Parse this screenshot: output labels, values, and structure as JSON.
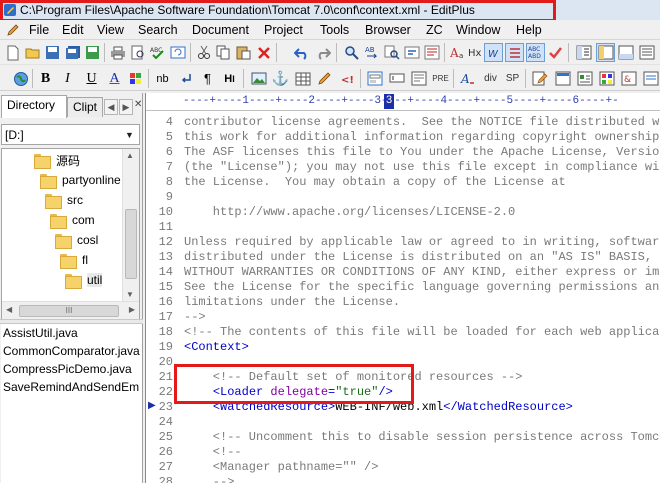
{
  "window": {
    "title": "C:\\Program Files\\Apache Software Foundation\\Tomcat 7.0\\conf\\context.xml - EditPlus",
    "app_icon": "editplus-icon"
  },
  "menu": [
    "File",
    "Edit",
    "View",
    "Search",
    "Document",
    "Project",
    "Tools",
    "Browser",
    "ZC",
    "Window",
    "Help"
  ],
  "toolbar2_labels": {
    "bold": "B",
    "italic": "I",
    "underline": "U",
    "fontcolor": "A",
    "nb": "nb",
    "pilcrow": "¶",
    "h": "H",
    "anchor": "⚓",
    "hx": "Hx",
    "pre": "PRE",
    "div": "div",
    "sp": "SP"
  },
  "sidebar": {
    "tabs": [
      "Directory",
      "Clipt"
    ],
    "drive": "[D:]",
    "tree": [
      {
        "label": "源码",
        "depth": 0
      },
      {
        "label": "partyonline",
        "depth": 1
      },
      {
        "label": "src",
        "depth": 2
      },
      {
        "label": "com",
        "depth": 3
      },
      {
        "label": "cosl",
        "depth": 4
      },
      {
        "label": "fl",
        "depth": 5
      },
      {
        "label": "util",
        "depth": 6,
        "selected": true
      }
    ],
    "hscroll_grip": "III",
    "files": [
      "AssistUtil.java",
      "CommonComparator.java",
      "CompressPicDemo.java",
      "SaveRemindAndSendEm"
    ]
  },
  "editor": {
    "ruler": "----+----1----+----2----+----3----+----4----+----5----+----6----+-",
    "cursor_column": "3",
    "current_line": "23",
    "lines": [
      {
        "n": "4",
        "segs": [
          [
            "c-comment",
            "contributor license agreements.  See the NOTICE file distributed w"
          ]
        ]
      },
      {
        "n": "5",
        "segs": [
          [
            "c-comment",
            "this work for additional information regarding copyright ownership"
          ]
        ]
      },
      {
        "n": "6",
        "segs": [
          [
            "c-comment",
            "The ASF licenses this file to You under the Apache License, Versio"
          ]
        ]
      },
      {
        "n": "7",
        "segs": [
          [
            "c-comment",
            "(the \"License\"); you may not use this file except in compliance wi"
          ]
        ]
      },
      {
        "n": "8",
        "segs": [
          [
            "c-comment",
            "the License.  You may obtain a copy of the License at"
          ]
        ]
      },
      {
        "n": "9",
        "segs": []
      },
      {
        "n": "10",
        "segs": [
          [
            "c-comment",
            "    http://www.apache.org/licenses/LICENSE-2.0"
          ]
        ]
      },
      {
        "n": "11",
        "segs": []
      },
      {
        "n": "12",
        "segs": [
          [
            "c-comment",
            "Unless required by applicable law or agreed to in writing, softwar"
          ]
        ]
      },
      {
        "n": "13",
        "segs": [
          [
            "c-comment",
            "distributed under the License is distributed on an \"AS IS\" BASIS,"
          ]
        ]
      },
      {
        "n": "14",
        "segs": [
          [
            "c-comment",
            "WITHOUT WARRANTIES OR CONDITIONS OF ANY KIND, either express or im"
          ]
        ]
      },
      {
        "n": "15",
        "segs": [
          [
            "c-comment",
            "See the License for the specific language governing permissions an"
          ]
        ]
      },
      {
        "n": "16",
        "segs": [
          [
            "c-comment",
            "limitations under the License."
          ]
        ]
      },
      {
        "n": "17",
        "segs": [
          [
            "c-comment",
            "-->"
          ]
        ]
      },
      {
        "n": "18",
        "segs": [
          [
            "c-comment",
            "<!-- The contents of this file will be loaded for each web applicati"
          ]
        ]
      },
      {
        "n": "19",
        "segs": [
          [
            "c-tag",
            "<Context>"
          ]
        ]
      },
      {
        "n": "20",
        "segs": []
      },
      {
        "n": "21",
        "segs": [
          [
            "c-comment",
            "    <!-- Default set of monitored resources -->"
          ]
        ]
      },
      {
        "n": "22",
        "segs": [
          [
            "c-plain",
            "    "
          ],
          [
            "c-tag",
            "<Loader "
          ],
          [
            "c-attr",
            "delegate"
          ],
          [
            "c-tag",
            "="
          ],
          [
            "c-val",
            "\"true\""
          ],
          [
            "c-tag",
            "/>"
          ]
        ]
      },
      {
        "n": "23",
        "segs": [
          [
            "c-plain",
            "    "
          ],
          [
            "c-tag",
            "<WatchedResource>"
          ],
          [
            "c-plain",
            "WEB-INF/web.xml"
          ],
          [
            "c-tag",
            "</WatchedResource>"
          ]
        ]
      },
      {
        "n": "24",
        "segs": []
      },
      {
        "n": "25",
        "segs": [
          [
            "c-comment",
            "    <!-- Uncomment this to disable session persistence across Tomcat"
          ]
        ]
      },
      {
        "n": "26",
        "segs": [
          [
            "c-comment",
            "    <!--"
          ]
        ]
      },
      {
        "n": "27",
        "segs": [
          [
            "c-comment",
            "    <Manager pathname=\"\" />"
          ]
        ]
      },
      {
        "n": "28",
        "segs": [
          [
            "c-comment",
            "    -->"
          ]
        ]
      }
    ]
  },
  "colors": {
    "annotation_red": "#e21a1a",
    "comment": "#7a7a7a",
    "tag": "#0000c8",
    "attr": "#8000a0",
    "value": "#1b6d1b"
  }
}
